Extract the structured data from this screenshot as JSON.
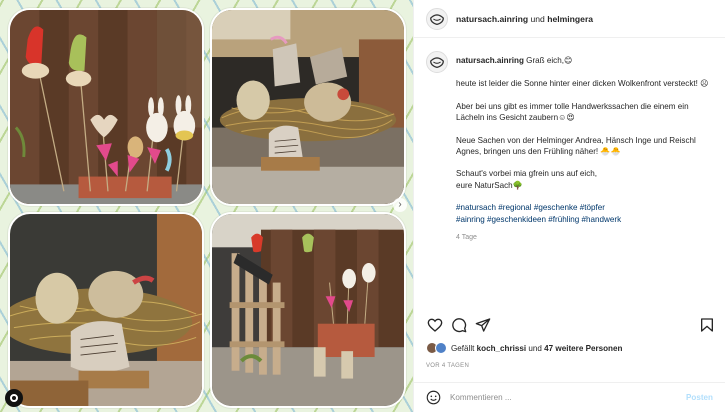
{
  "header": {
    "account": "natursach.ainring",
    "joiner": "und",
    "collaborator": "helmingera"
  },
  "caption": {
    "author": "natursach.ainring",
    "first_line": "Graß eich,😊",
    "p1": "heute ist leider die Sonne hinter einer dicken Wolkenfront verstecktǃ ☹",
    "p2": "Aber bei uns gibt es immer tolle Handwerkssachen die einem ein Lächeln ins Gesicht zaubern☺😍",
    "p3": "Neue Sachen von der Helminger Andrea, Hänsch Inge und Reischl Agnes, bringen uns den Frühling näher! 🐣🐣",
    "p4_line1": "Schaut's vorbei mia gfrein uns auf eich,",
    "p4_line2": "eure NaturSach🌳",
    "tags_line1": "#natursach #regional #geschenke #töpfer",
    "tags_line2": "#ainring #geschenkideen #frühling #handwerk",
    "timestamp": "4 Tage"
  },
  "likes": {
    "prefix": "Gefällt",
    "user": "koch_chrissi",
    "middle": "und",
    "others": "47 weitere Personen"
  },
  "date_label": "VOR 4 TAGEN",
  "composer": {
    "placeholder": "Kommentieren ...",
    "post_label": "Posten"
  },
  "icons": {
    "like": "heart-icon",
    "comment": "comment-icon",
    "share": "paper-plane-icon",
    "save": "bookmark-icon",
    "emoji": "smiley-icon"
  },
  "colors": {
    "link": "#00376b",
    "muted": "#8e8e8e",
    "post_button": "#b2dffc"
  }
}
